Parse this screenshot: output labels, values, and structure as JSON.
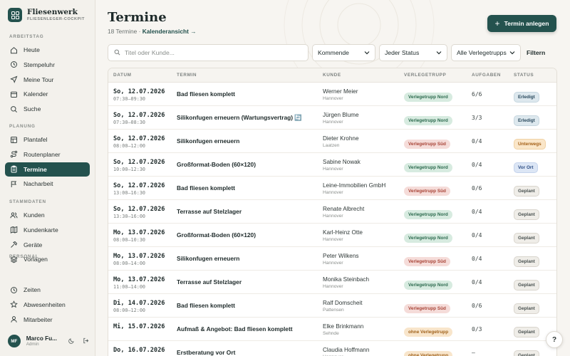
{
  "brand": {
    "name": "Fliesenwerk",
    "subtitle": "FLIESENLEGER-COCKPIT"
  },
  "sidebar": {
    "sections": [
      {
        "label": "ARBEITSTAG",
        "items": [
          {
            "label": "Heute",
            "icon": "home-icon"
          },
          {
            "label": "Stempeluhr",
            "icon": "clock-icon"
          },
          {
            "label": "Meine Tour",
            "icon": "navigation-icon"
          },
          {
            "label": "Kalender",
            "icon": "calendar-icon"
          },
          {
            "label": "Suche",
            "icon": "search-icon"
          }
        ]
      },
      {
        "label": "PLANUNG",
        "items": [
          {
            "label": "Plantafel",
            "icon": "board-icon"
          },
          {
            "label": "Routenplaner",
            "icon": "route-icon"
          },
          {
            "label": "Termine",
            "icon": "clipboard-icon",
            "active": true
          },
          {
            "label": "Nacharbeit",
            "icon": "flag-icon"
          }
        ]
      },
      {
        "label": "STAMMDATEN",
        "items": [
          {
            "label": "Kunden",
            "icon": "users-icon"
          },
          {
            "label": "Kundenkarte",
            "icon": "map-icon"
          },
          {
            "label": "Geräte",
            "icon": "hammer-icon"
          },
          {
            "label": "Vorlagen",
            "icon": "layers-icon"
          }
        ]
      },
      {
        "label": "PERSONAL",
        "items": [
          {
            "label": "Zeiten",
            "icon": "clock-icon"
          },
          {
            "label": "Abwesenheiten",
            "icon": "star-icon"
          },
          {
            "label": "Mitarbeiter",
            "icon": "user-icon"
          }
        ]
      }
    ]
  },
  "user": {
    "initials": "MF",
    "name": "Marco Fu...",
    "role": "Admin"
  },
  "page": {
    "title": "Termine",
    "count_text": "18 Termine · ",
    "calendar_link": "Kalenderansicht →",
    "new_button": "Termin anlegen"
  },
  "filters": {
    "search_placeholder": "Titel oder Kunde...",
    "period": "Kommende",
    "status": "Jeder Status",
    "team": "Alle Verlegetrupps",
    "filter_button": "Filtern"
  },
  "table": {
    "columns": [
      "DATUM",
      "TERMIN",
      "KUNDE",
      "VERLEGETRUPP",
      "AUFGABEN",
      "STATUS"
    ],
    "rows": [
      {
        "date": "So, 12.07.2026",
        "time": "07:30–09:30",
        "title": "Bad fliesen komplett",
        "customer": "Werner Meier",
        "city": "Hannover",
        "team": "Verlegetrupp Nord",
        "team_type": "nord",
        "tasks": "6/6",
        "status": "Erledigt",
        "status_type": "erledigt"
      },
      {
        "date": "So, 12.07.2026",
        "time": "07:30–08:30",
        "title": "Silikonfugen erneuern (Wartungsvertrag) 🔄",
        "customer": "Jürgen Blume",
        "city": "Hannover",
        "team": "Verlegetrupp Nord",
        "team_type": "nord",
        "tasks": "3/3",
        "status": "Erledigt",
        "status_type": "erledigt"
      },
      {
        "date": "So, 12.07.2026",
        "time": "08:00–12:00",
        "title": "Silikonfugen erneuern",
        "customer": "Dieter Krohne",
        "city": "Laatzen",
        "team": "Verlegetrupp Süd",
        "team_type": "sued",
        "tasks": "0/4",
        "status": "Unterwegs",
        "status_type": "unterwegs"
      },
      {
        "date": "So, 12.07.2026",
        "time": "10:00–12:30",
        "title": "Großformat-Boden (60×120)",
        "customer": "Sabine Nowak",
        "city": "Hannover",
        "team": "Verlegetrupp Nord",
        "team_type": "nord",
        "tasks": "0/4",
        "status": "Vor Ort",
        "status_type": "vorort"
      },
      {
        "date": "So, 12.07.2026",
        "time": "13:00–16:30",
        "title": "Bad fliesen komplett",
        "customer": "Leine-Immobilien GmbH",
        "city": "Hannover",
        "team": "Verlegetrupp Süd",
        "team_type": "sued",
        "tasks": "0/6",
        "status": "Geplant",
        "status_type": "geplant"
      },
      {
        "date": "So, 12.07.2026",
        "time": "13:30–16:00",
        "title": "Terrasse auf Stelzlager",
        "customer": "Renate Albrecht",
        "city": "Hannover",
        "team": "Verlegetrupp Nord",
        "team_type": "nord",
        "tasks": "0/4",
        "status": "Geplant",
        "status_type": "geplant"
      },
      {
        "date": "Mo, 13.07.2026",
        "time": "08:00–10:30",
        "title": "Großformat-Boden (60×120)",
        "customer": "Karl-Heinz Otte",
        "city": "Hannover",
        "team": "Verlegetrupp Nord",
        "team_type": "nord",
        "tasks": "0/4",
        "status": "Geplant",
        "status_type": "geplant"
      },
      {
        "date": "Mo, 13.07.2026",
        "time": "08:00–14:00",
        "title": "Silikonfugen erneuern",
        "customer": "Peter Wilkens",
        "city": "Hannover",
        "team": "Verlegetrupp Süd",
        "team_type": "sued",
        "tasks": "0/4",
        "status": "Geplant",
        "status_type": "geplant"
      },
      {
        "date": "Mo, 13.07.2026",
        "time": "11:00–14:00",
        "title": "Terrasse auf Stelzlager",
        "customer": "Monika Steinbach",
        "city": "Hannover",
        "team": "Verlegetrupp Nord",
        "team_type": "nord",
        "tasks": "0/4",
        "status": "Geplant",
        "status_type": "geplant"
      },
      {
        "date": "Di, 14.07.2026",
        "time": "08:00–12:00",
        "title": "Bad fliesen komplett",
        "customer": "Ralf Domscheit",
        "city": "Pattensen",
        "team": "Verlegetrupp Süd",
        "team_type": "sued",
        "tasks": "0/6",
        "status": "Geplant",
        "status_type": "geplant"
      },
      {
        "date": "Mi, 15.07.2026",
        "time": "",
        "title": "Aufmaß & Angebot: Bad fliesen komplett",
        "customer": "Elke Brinkmann",
        "city": "Sehnde",
        "team": "ohne Verlegetrupp",
        "team_type": "none",
        "tasks": "0/3",
        "status": "Geplant",
        "status_type": "geplant"
      },
      {
        "date": "Do, 16.07.2026",
        "time": "",
        "title": "Erstberatung vor Ort",
        "customer": "Claudia Hoffmann",
        "city": "Hannover",
        "team": "ohne Verlegetrupp",
        "team_type": "none",
        "tasks": "–",
        "status": "Geplant",
        "status_type": "geplant"
      }
    ]
  },
  "help_label": "?",
  "colors": {
    "primary": "#24524e",
    "background": "#f7f5f1"
  }
}
